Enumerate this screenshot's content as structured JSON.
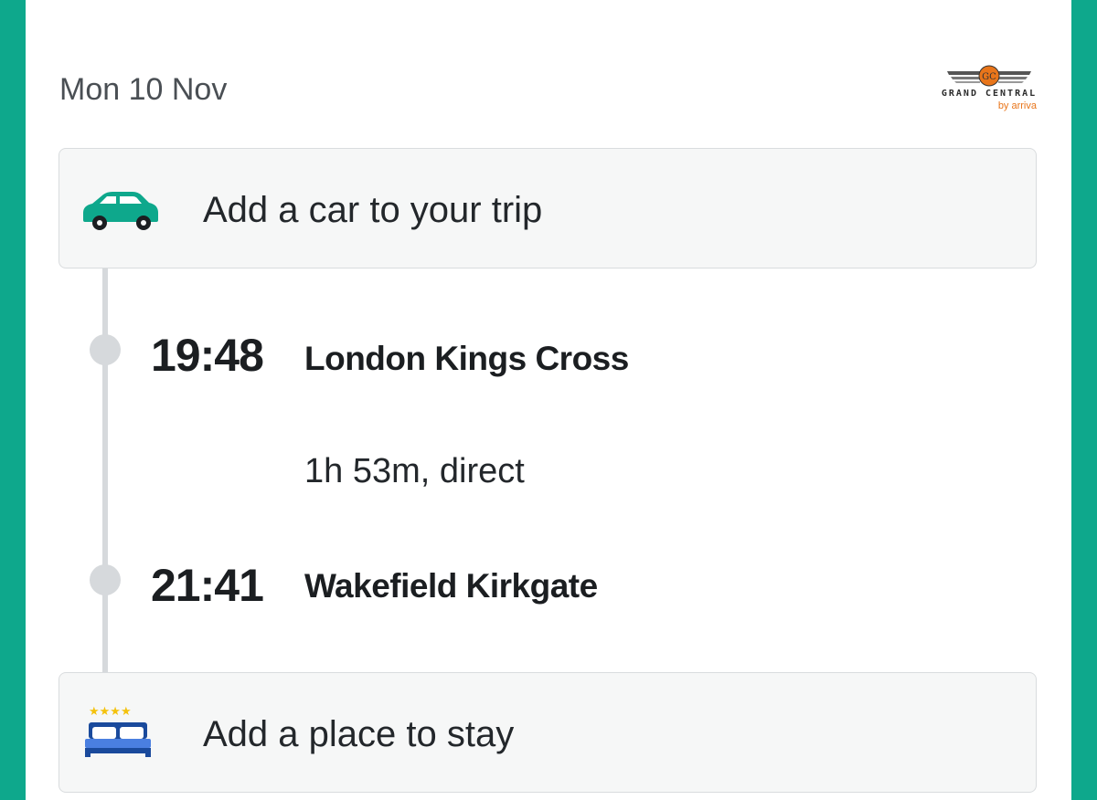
{
  "trip": {
    "date": "Mon 10 Nov",
    "operator": {
      "name": "GRAND CENTRAL",
      "sub": "by arriva",
      "monogram": "GC",
      "brand_color": "#e8751a"
    },
    "car_card": {
      "label": "Add a car to your trip",
      "icon": "car-icon",
      "icon_color": "#0ea88c"
    },
    "journey": {
      "departure": {
        "time": "19:48",
        "station": "London Kings Cross"
      },
      "summary": "1h 53m, direct",
      "arrival": {
        "time": "21:41",
        "station": "Wakefield Kirkgate"
      }
    },
    "hotel_card": {
      "label": "Add a place to stay",
      "icon": "bed-icon",
      "stars": "★★★★",
      "icon_color": "#1a4a9c"
    }
  },
  "colors": {
    "background_accent": "#0ea88c",
    "card_bg": "#f6f7f7",
    "timeline": "#d6d9dc"
  }
}
